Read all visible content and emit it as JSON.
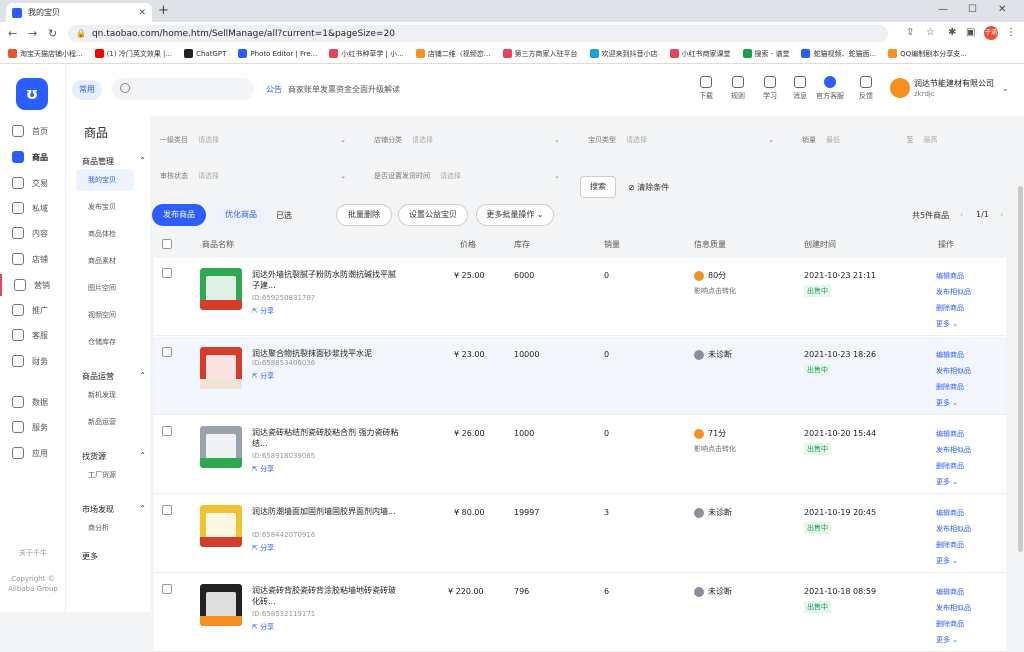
{
  "browser": {
    "tab_title": "我的宝贝",
    "url": "qn.taobao.com/home.htm/SellManage/all?current=1&pageSize=20",
    "profile": "子涵",
    "bookmarks": [
      {
        "label": "淘宝天猫店铺小程...",
        "color": "#e8512f"
      },
      {
        "label": "(1) 冷门英文效果 |...",
        "color": "#ff0000"
      },
      {
        "label": "ChatGPT",
        "color": "#222222"
      },
      {
        "label": "Photo Editor | Fre...",
        "color": "#2b5dff"
      },
      {
        "label": "小红书种草学 | 小...",
        "color": "#e9425b"
      },
      {
        "label": "店铺二维（视频恋...",
        "color": "#f59023"
      },
      {
        "label": "第三方商家入驻平台",
        "color": "#e9425b"
      },
      {
        "label": "欢迎来到抖音小店",
        "color": "#1aa3d9"
      },
      {
        "label": "小红书商家课堂",
        "color": "#e9425b"
      },
      {
        "label": "搜索 - 谱堂",
        "color": "#1a9e4b"
      },
      {
        "label": "蛇猫视频、蛇猫面...",
        "color": "#2b5dff"
      },
      {
        "label": "QQ编制剧本分享支...",
        "color": "#f59023"
      }
    ]
  },
  "app": {
    "logo": "ʊ",
    "left_nav": [
      {
        "label": "首页",
        "name": "home"
      },
      {
        "label": "商品",
        "name": "goods"
      },
      {
        "label": "交易",
        "name": "trade"
      },
      {
        "label": "私域",
        "name": "private-domain"
      },
      {
        "label": "内容",
        "name": "content"
      },
      {
        "label": "店铺",
        "name": "shop"
      },
      {
        "label": "营销",
        "name": "marketing"
      },
      {
        "label": "推广",
        "name": "promotion"
      },
      {
        "label": "客服",
        "name": "customer-service"
      },
      {
        "label": "财务",
        "name": "finance"
      },
      {
        "label": "数据",
        "name": "data"
      },
      {
        "label": "服务",
        "name": "services"
      },
      {
        "label": "应用",
        "name": "apps"
      }
    ],
    "left_footer": {
      "about": "关于千牛",
      "copyright": "Copyright © Alibaba Group"
    },
    "topbar": {
      "common_chip": "常用",
      "notice_label": "公告",
      "notice_text": "商家账单发票资金全面升级解读",
      "icons": [
        {
          "label": "下载",
          "name": "download"
        },
        {
          "label": "规则",
          "name": "rules"
        },
        {
          "label": "学习",
          "name": "learn"
        },
        {
          "label": "消息",
          "name": "messages"
        },
        {
          "label": "官方客服",
          "name": "official-service"
        },
        {
          "label": "反馈",
          "name": "feedback"
        }
      ],
      "store_name": "润达节能建材有限公司",
      "store_id": "zkrdjc"
    },
    "subnav": {
      "title": "商品",
      "sections": [
        {
          "label": "商品管理",
          "items": [
            "我的宝贝",
            "发布宝贝",
            "商品体检",
            "商品素材",
            "图片空间",
            "视频空间",
            "仓储库存"
          ]
        },
        {
          "label": "商品运营",
          "items": [
            "新机发现",
            "新品运营"
          ]
        },
        {
          "label": "找货源",
          "items": [
            "工厂货源"
          ]
        },
        {
          "label": "市场发现",
          "items": [
            "商分析"
          ]
        }
      ],
      "more": "更多"
    }
  },
  "filters": [
    {
      "label": "一级类目",
      "placeholder": "请选择"
    },
    {
      "label": "店铺分类",
      "placeholder": "请选择"
    },
    {
      "label": "宝贝类型",
      "placeholder": "请选择"
    },
    {
      "label": "销量",
      "placeholder": "最低",
      "placeholder2": "最高"
    },
    {
      "label": "审核状态",
      "placeholder": "请选择"
    },
    {
      "label": "是否设置发货时间",
      "placeholder": "请选择"
    }
  ],
  "actions": {
    "search": "搜索",
    "clear": "清除条件",
    "publish": "发布商品",
    "optimize": "优化商品",
    "selected": "已选",
    "batch_delete": "批量删除",
    "set_welfare": "设置公益宝贝",
    "more_batch": "更多批量操作",
    "total": "共5件商品",
    "pager": "1/1"
  },
  "table": {
    "headers": [
      "商品名称",
      "价格",
      "库存",
      "销量",
      "信息质量",
      "创建时间",
      "操作"
    ],
    "rows": [
      {
        "title": "润达外墙抗裂腻子粉防水防潮抗碱找平腻子建...",
        "id": "ID:659250831797",
        "share": "分享",
        "price": "¥ 25.00",
        "stock": "6000",
        "sales": "0",
        "quality": "80分",
        "quality_sub": "影响点击转化",
        "quality_color": "#f59023",
        "date": "2021-10-23 21:11",
        "status": "出售中",
        "thumb": [
          "#2fa84f",
          "#d43c2b"
        ]
      },
      {
        "title": "润达聚合物抗裂抹面砂浆找平水泥",
        "id": "ID:658853406036",
        "share": "分享",
        "price": "¥ 23.00",
        "stock": "10000",
        "sales": "0",
        "quality": "未诊断",
        "quality_sub": "",
        "quality_color": "#8a8f99",
        "date": "2021-10-23 18:26",
        "status": "出售中",
        "thumb": [
          "#d43c2b",
          "#f0e4d8"
        ]
      },
      {
        "title": "润达瓷砖粘结剂瓷砖胶粘合剂 强力瓷砖粘结...",
        "id": "ID:658918039065",
        "share": "分享",
        "price": "¥ 26.00",
        "stock": "1000",
        "sales": "0",
        "quality": "71分",
        "quality_sub": "影响点击转化",
        "quality_color": "#f59023",
        "date": "2021-10-20 15:44",
        "status": "出售中",
        "thumb": [
          "#9aa3ad",
          "#2fa84f"
        ]
      },
      {
        "title": "润达防潮墙面加固剂墙固胶界面剂内墙...",
        "id": "ID:658442070916",
        "share": "分享",
        "price": "¥ 80.00",
        "stock": "19997",
        "sales": "3",
        "quality": "未诊断",
        "quality_sub": "",
        "quality_color": "#8a8f99",
        "date": "2021-10-19 20:45",
        "status": "出售中",
        "thumb": [
          "#f1c232",
          "#d43c2b"
        ]
      },
      {
        "title": "润达瓷砖背胶瓷砖背涂胶粘墙地砖瓷砖玻化砖...",
        "id": "ID:658532119171",
        "share": "分享",
        "price": "¥ 220.00",
        "stock": "796",
        "sales": "6",
        "quality": "未诊断",
        "quality_sub": "",
        "quality_color": "#8a8f99",
        "date": "2021-10-18 08:59",
        "status": "出售中",
        "thumb": [
          "#222222",
          "#f59023"
        ]
      }
    ],
    "row_actions": [
      "编辑商品",
      "发布相似品",
      "删除商品",
      "更多"
    ]
  }
}
